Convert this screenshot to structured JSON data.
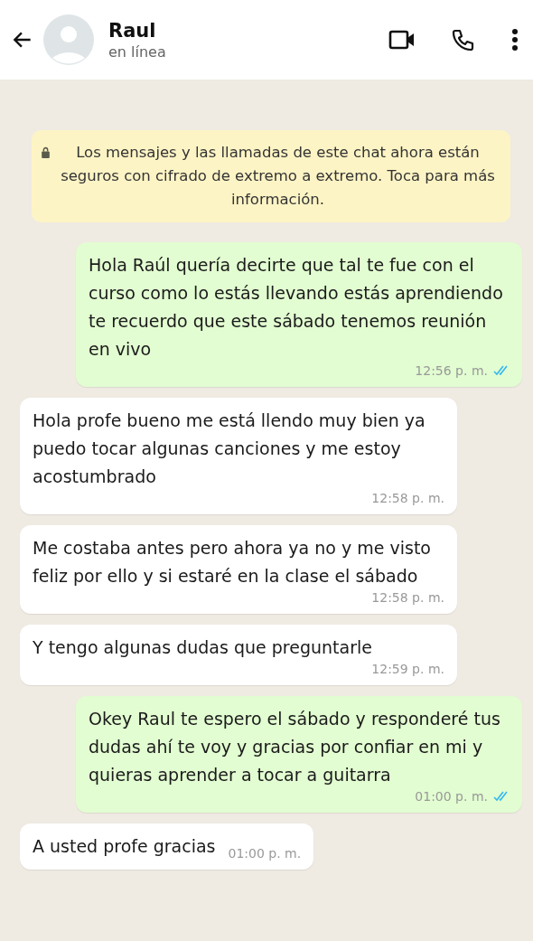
{
  "header": {
    "contact_name": "Raul",
    "status": "en línea"
  },
  "notice": {
    "text": "Los mensajes y las llamadas de este chat ahora están seguros con cifrado de extremo a extremo. Toca para más información."
  },
  "messages": [
    {
      "kind": "out",
      "text": "Hola Raúl quería decirte que tal te fue con el curso como lo estás llevando estás aprendiendo te recuerdo que este sábado tenemos reunión en vivo",
      "time": "12:56 p. m.",
      "read": true
    },
    {
      "kind": "in",
      "text": "Hola profe bueno me está llendo muy bien ya puedo tocar algunas canciones y me estoy acostumbrado",
      "time": "12:58 p. m."
    },
    {
      "kind": "in",
      "text": "Me costaba antes pero ahora ya no y me visto feliz por ello y si estaré en la clase el sábado",
      "time": "12:58 p. m."
    },
    {
      "kind": "in",
      "text": "Y tengo algunas dudas que preguntarle",
      "time": "12:59 p. m."
    },
    {
      "kind": "out",
      "text": "Okey Raul te espero el sábado y responderé tus dudas ahí te voy y gracias por confiar en mi y quieras aprender a tocar a guitarra",
      "time": "01:00 p. m.",
      "read": true
    },
    {
      "kind": "in",
      "text": "A usted profe gracias",
      "time": "01:00 p. m."
    }
  ]
}
